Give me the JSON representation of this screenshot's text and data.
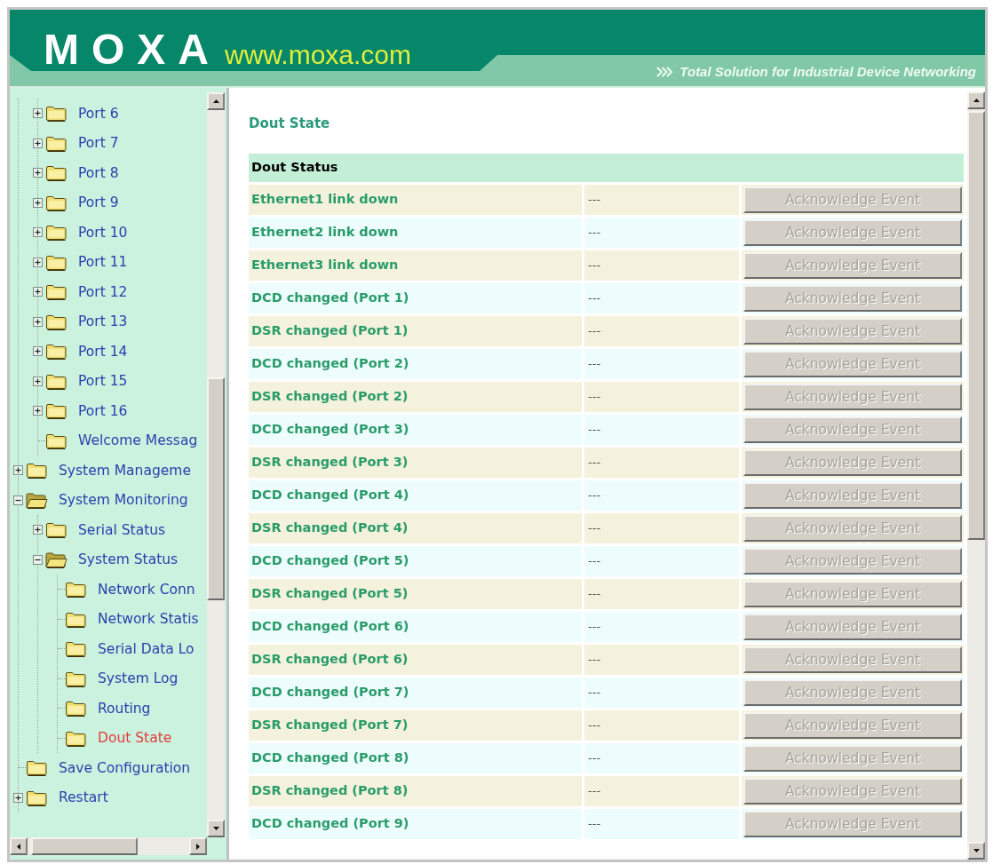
{
  "header": {
    "logo": "MOXA",
    "url": "www.moxa.com",
    "tagline": "Total Solution for Industrial Device Networking"
  },
  "tree": [
    {
      "children": [
        {
          "label": "Port 6",
          "expanded": false,
          "selected": false
        },
        {
          "label": "Port 7",
          "expanded": false,
          "selected": false
        },
        {
          "label": "Port 8",
          "expanded": false,
          "selected": false
        },
        {
          "label": "Port 9",
          "expanded": false,
          "selected": false
        },
        {
          "label": "Port 10",
          "expanded": false,
          "selected": false
        },
        {
          "label": "Port 11",
          "expanded": false,
          "selected": false
        },
        {
          "label": "Port 12",
          "expanded": false,
          "selected": false
        },
        {
          "label": "Port 13",
          "expanded": false,
          "selected": false
        },
        {
          "label": "Port 14",
          "expanded": false,
          "selected": false
        },
        {
          "label": "Port 15",
          "expanded": false,
          "selected": false
        },
        {
          "label": "Port 16",
          "expanded": false,
          "selected": false
        },
        {
          "label": "Welcome Messag",
          "selected": false
        }
      ]
    },
    {
      "label": "System Manageme",
      "expanded": false,
      "selected": false
    },
    {
      "label": "System Monitoring",
      "expanded": true,
      "selected": false,
      "children": [
        {
          "label": "Serial Status",
          "expanded": false,
          "selected": false
        },
        {
          "label": "System Status",
          "expanded": true,
          "selected": false,
          "children": [
            {
              "label": "Network Conn",
              "selected": false
            },
            {
              "label": "Network Statis",
              "selected": false
            },
            {
              "label": "Serial Data Lo",
              "selected": false
            },
            {
              "label": "System Log",
              "selected": false
            },
            {
              "label": "Routing",
              "selected": false
            },
            {
              "label": "Dout State",
              "selected": true
            }
          ]
        }
      ]
    },
    {
      "label": "Save Configuration",
      "selected": false
    },
    {
      "label": "Restart",
      "expanded": false,
      "selected": false
    }
  ],
  "page_title": "Dout State",
  "table": {
    "title": "Dout Status",
    "rows": [
      {
        "event": "Ethernet1 link down",
        "value": "---",
        "action": "Acknowledge Event",
        "disabled": true
      },
      {
        "event": "Ethernet2 link down",
        "value": "---",
        "action": "Acknowledge Event",
        "disabled": true
      },
      {
        "event": "Ethernet3 link down",
        "value": "---",
        "action": "Acknowledge Event",
        "disabled": true
      },
      {
        "event": "DCD changed (Port 1)",
        "value": "---",
        "action": "Acknowledge Event",
        "disabled": true
      },
      {
        "event": "DSR changed (Port 1)",
        "value": "---",
        "action": "Acknowledge Event",
        "disabled": true
      },
      {
        "event": "DCD changed (Port 2)",
        "value": "---",
        "action": "Acknowledge Event",
        "disabled": true
      },
      {
        "event": "DSR changed (Port 2)",
        "value": "---",
        "action": "Acknowledge Event",
        "disabled": true
      },
      {
        "event": "DCD changed (Port 3)",
        "value": "---",
        "action": "Acknowledge Event",
        "disabled": true
      },
      {
        "event": "DSR changed (Port 3)",
        "value": "---",
        "action": "Acknowledge Event",
        "disabled": true
      },
      {
        "event": "DCD changed (Port 4)",
        "value": "---",
        "action": "Acknowledge Event",
        "disabled": true
      },
      {
        "event": "DSR changed (Port 4)",
        "value": "---",
        "action": "Acknowledge Event",
        "disabled": true
      },
      {
        "event": "DCD changed (Port 5)",
        "value": "---",
        "action": "Acknowledge Event",
        "disabled": true
      },
      {
        "event": "DSR changed (Port 5)",
        "value": "---",
        "action": "Acknowledge Event",
        "disabled": true
      },
      {
        "event": "DCD changed (Port 6)",
        "value": "---",
        "action": "Acknowledge Event",
        "disabled": true
      },
      {
        "event": "DSR changed (Port 6)",
        "value": "---",
        "action": "Acknowledge Event",
        "disabled": true
      },
      {
        "event": "DCD changed (Port 7)",
        "value": "---",
        "action": "Acknowledge Event",
        "disabled": true
      },
      {
        "event": "DSR changed (Port 7)",
        "value": "---",
        "action": "Acknowledge Event",
        "disabled": true
      },
      {
        "event": "DCD changed (Port 8)",
        "value": "---",
        "action": "Acknowledge Event",
        "disabled": true
      },
      {
        "event": "DSR changed (Port 8)",
        "value": "---",
        "action": "Acknowledge Event",
        "disabled": true
      },
      {
        "event": "DCD changed (Port 9)",
        "value": "---",
        "action": "Acknowledge Event",
        "disabled": true
      }
    ]
  }
}
